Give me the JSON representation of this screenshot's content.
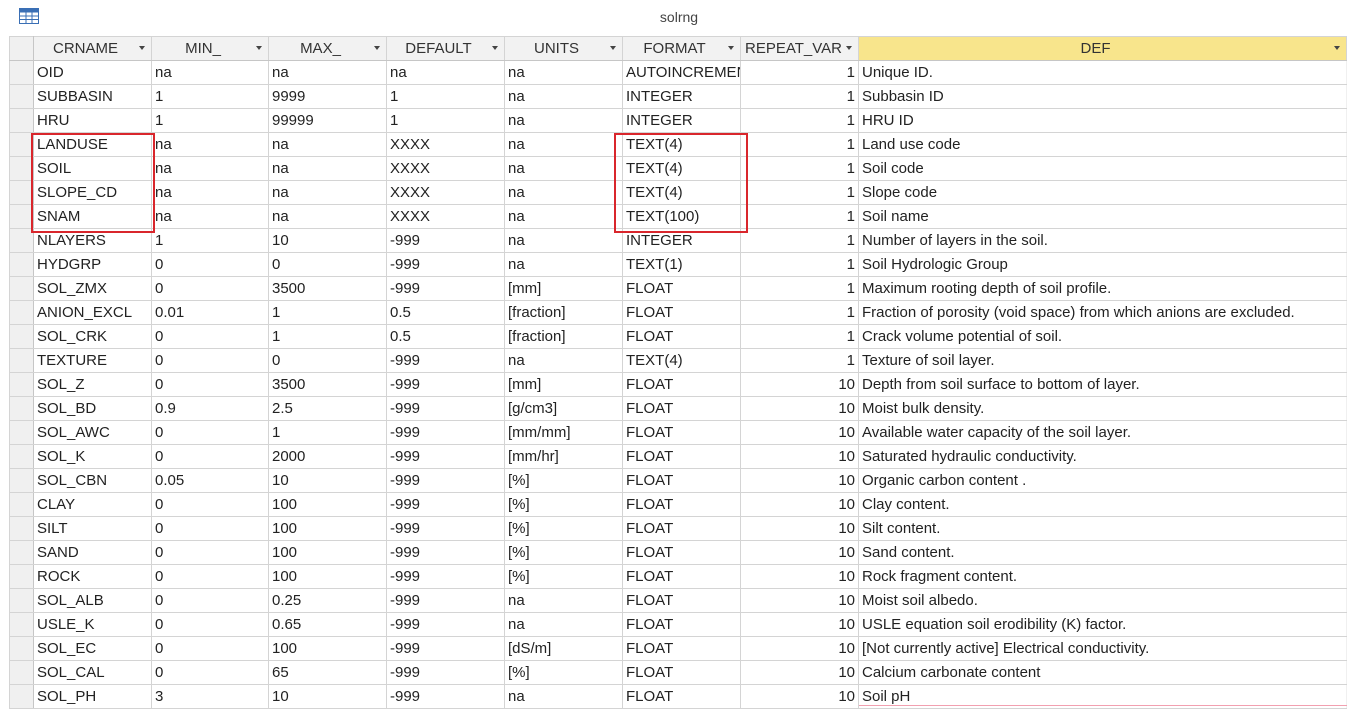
{
  "window": {
    "title": "solrng",
    "icon": "table-icon"
  },
  "columns": [
    {
      "key": "CRNAME",
      "label": "CRNAME"
    },
    {
      "key": "MIN_",
      "label": "MIN_"
    },
    {
      "key": "MAX_",
      "label": "MAX_"
    },
    {
      "key": "DEFAULT",
      "label": "DEFAULT"
    },
    {
      "key": "UNITS",
      "label": "UNITS"
    },
    {
      "key": "FORMAT",
      "label": "FORMAT"
    },
    {
      "key": "REPEAT_VAR",
      "label": "REPEAT_VAR"
    },
    {
      "key": "DEF",
      "label": "DEF"
    }
  ],
  "rows": [
    [
      "OID",
      "na",
      "na",
      "na",
      "na",
      "AUTOINCREMENT",
      "1",
      "Unique ID."
    ],
    [
      "SUBBASIN",
      "1",
      "9999",
      "1",
      "na",
      "INTEGER",
      "1",
      "Subbasin ID"
    ],
    [
      "HRU",
      "1",
      "99999",
      "1",
      "na",
      "INTEGER",
      "1",
      "HRU ID"
    ],
    [
      "LANDUSE",
      "na",
      "na",
      "XXXX",
      "na",
      "TEXT(4)",
      "1",
      "Land use code"
    ],
    [
      "SOIL",
      "na",
      "na",
      "XXXX",
      "na",
      "TEXT(4)",
      "1",
      "Soil code"
    ],
    [
      "SLOPE_CD",
      "na",
      "na",
      "XXXX",
      "na",
      "TEXT(4)",
      "1",
      "Slope code"
    ],
    [
      "SNAM",
      "na",
      "na",
      "XXXX",
      "na",
      "TEXT(100)",
      "1",
      "Soil name"
    ],
    [
      "NLAYERS",
      "1",
      "10",
      "-999",
      "na",
      "INTEGER",
      "1",
      "Number of layers in the soil."
    ],
    [
      "HYDGRP",
      "0",
      "0",
      "-999",
      "na",
      "TEXT(1)",
      "1",
      "Soil Hydrologic Group"
    ],
    [
      "SOL_ZMX",
      "0",
      "3500",
      "-999",
      "[mm]",
      "FLOAT",
      "1",
      "Maximum rooting depth of soil profile."
    ],
    [
      "ANION_EXCL",
      "0.01",
      "1",
      "0.5",
      "[fraction]",
      "FLOAT",
      "1",
      "Fraction of porosity (void space) from which anions are excluded."
    ],
    [
      "SOL_CRK",
      "0",
      "1",
      "0.5",
      "[fraction]",
      "FLOAT",
      "1",
      " Crack volume potential of soil."
    ],
    [
      "TEXTURE",
      "0",
      "0",
      "-999",
      "na",
      "TEXT(4)",
      "1",
      " Texture of soil layer."
    ],
    [
      "SOL_Z",
      "0",
      "3500",
      "-999",
      "[mm]",
      "FLOAT",
      "10",
      "Depth from soil surface to bottom of layer."
    ],
    [
      "SOL_BD",
      "0.9",
      "2.5",
      "-999",
      "[g/cm3]",
      "FLOAT",
      "10",
      "Moist bulk density."
    ],
    [
      "SOL_AWC",
      "0",
      "1",
      "-999",
      "[mm/mm]",
      "FLOAT",
      "10",
      "Available water capacity of the soil layer."
    ],
    [
      "SOL_K",
      "0",
      "2000",
      "-999",
      "[mm/hr]",
      "FLOAT",
      "10",
      "Saturated hydraulic conductivity."
    ],
    [
      "SOL_CBN",
      "0.05",
      "10",
      "-999",
      "[%]",
      "FLOAT",
      "10",
      "Organic carbon content ."
    ],
    [
      "CLAY",
      "0",
      "100",
      "-999",
      "[%]",
      "FLOAT",
      "10",
      "Clay content."
    ],
    [
      "SILT",
      "0",
      "100",
      "-999",
      "[%]",
      "FLOAT",
      "10",
      "Silt content."
    ],
    [
      "SAND",
      "0",
      "100",
      "-999",
      "[%]",
      "FLOAT",
      "10",
      "Sand content."
    ],
    [
      "ROCK",
      "0",
      "100",
      "-999",
      "[%]",
      "FLOAT",
      "10",
      "Rock fragment content."
    ],
    [
      "SOL_ALB",
      "0",
      "0.25",
      "-999",
      "na",
      "FLOAT",
      "10",
      "Moist soil albedo."
    ],
    [
      "USLE_K",
      "0",
      "0.65",
      "-999",
      "na",
      "FLOAT",
      "10",
      "USLE equation soil erodibility (K) factor."
    ],
    [
      "SOL_EC",
      "0",
      "100",
      "-999",
      "[dS/m]",
      "FLOAT",
      "10",
      "[Not currently active] Electrical conductivity."
    ],
    [
      "SOL_CAL",
      "0",
      "65",
      "-999",
      "[%]",
      "FLOAT",
      "10",
      "Calcium carbonate content"
    ],
    [
      "SOL_PH",
      "3",
      "10",
      "-999",
      "na",
      "FLOAT",
      "10",
      "Soil pH"
    ]
  ],
  "highlight_color": "#d9262c",
  "def_header_color": "#f8e58c"
}
